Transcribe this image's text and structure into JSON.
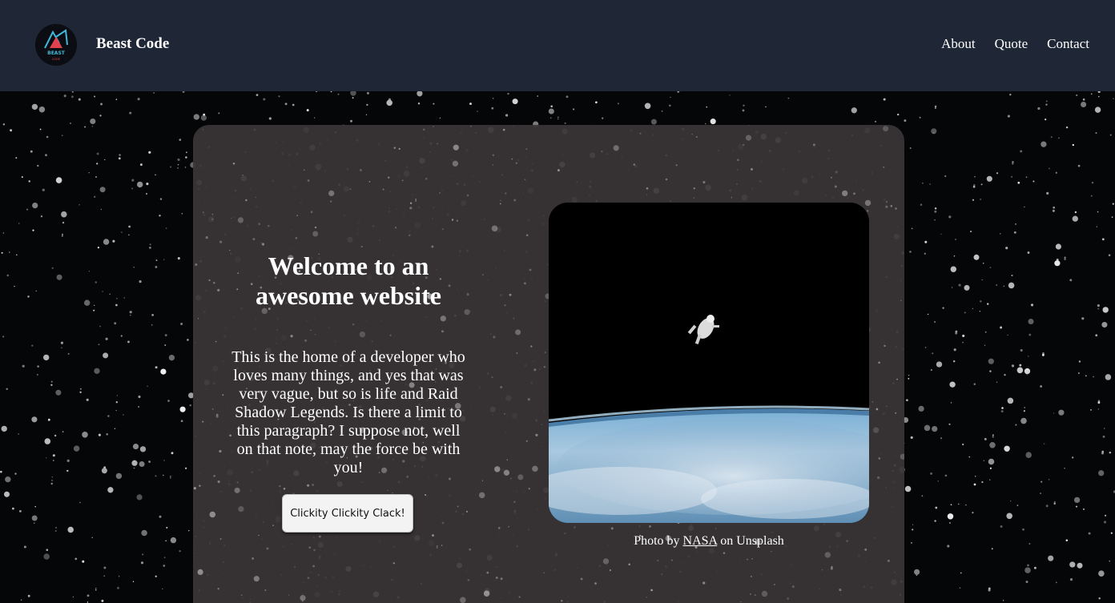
{
  "header": {
    "brand": "Beast Code",
    "logo_text": "BEAST",
    "logo_subtext": "CODE",
    "nav": [
      "About",
      "Quote",
      "Contact"
    ]
  },
  "hero": {
    "title": "Welcome to an awesome website",
    "text": "This is the home of a developer who loves many things, and yes that was very vague, but so is life and Raid Shadow Legends. Is there a limit to this paragraph? I suppose not, well on that note, may the force be with you!",
    "button_label": "Clickity Clickity Clack!"
  },
  "photo": {
    "credit_prefix": "Photo by",
    "credit_link": "NASA",
    "credit_suffix": "on Unsplash"
  },
  "colors": {
    "header_bg": "#1f2736",
    "card_bg": "#3a3638",
    "accent": "#e0434d",
    "logo_cyan": "#3fb9d8"
  }
}
